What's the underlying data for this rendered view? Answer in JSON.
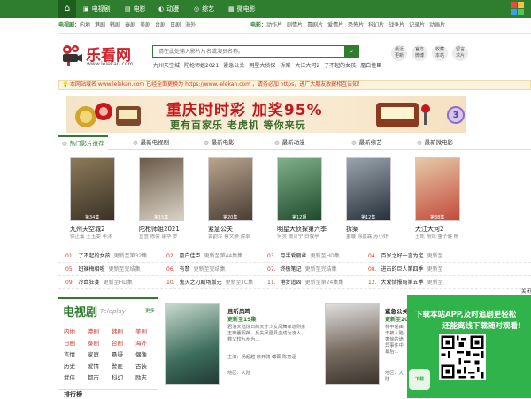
{
  "topnav": {
    "home_icon": "home-icon",
    "items": [
      {
        "label": "电视剧",
        "icon": "tv-icon",
        "glyph": "▣"
      },
      {
        "label": "电影",
        "icon": "film-icon",
        "glyph": "▤"
      },
      {
        "label": "动漫",
        "icon": "anime-icon",
        "glyph": "◐"
      },
      {
        "label": "综艺",
        "icon": "variety-icon",
        "glyph": "◎"
      },
      {
        "label": "微电影",
        "icon": "micro-film-icon",
        "glyph": "▦"
      }
    ]
  },
  "category_rows": {
    "tv": {
      "title": "电视剧：",
      "items": [
        "内地",
        "港剧",
        "韩剧",
        "泰剧",
        "美剧",
        "台剧",
        "日剧",
        "海外"
      ]
    },
    "movie": {
      "title": "电影：",
      "items": [
        "动作片",
        "剧情片",
        "喜剧片",
        "爱情片",
        "恐怖片",
        "科幻片",
        "战争片",
        "记录片",
        "动画片"
      ]
    }
  },
  "logo": {
    "name": "乐看网",
    "url": "www.lelekan.com"
  },
  "search": {
    "placeholder": "请在此处输入影片片名或演员名称。",
    "button": "⌕"
  },
  "hotwords": [
    "九州天空城",
    "陀枪师姐2021",
    "紧急公关",
    "明星大侦探",
    "拆案",
    "大江大河2",
    "了不起的女孩",
    "凰白佳臣"
  ],
  "circle_buttons": [
    {
      "line1": "最近",
      "line2": "更新"
    },
    {
      "line1": "官方",
      "line2": "微博"
    },
    {
      "line1": "收藏",
      "line2": "本站"
    },
    {
      "line1": "留言",
      "line2": "求片"
    }
  ],
  "notice": {
    "icon": "💡",
    "text": "本网站域名 www.lelekan.com 已经全面更换为 https://www.lelekan.com ，请务必加 https，进广大朋友收藏相互告知！"
  },
  "banner": {
    "line1": "重庆时时彩 加奖95%",
    "line2": "更有百家乐 老虎机 等你来玩",
    "badge": "3"
  },
  "tabs": [
    {
      "label": "热门影片推荐",
      "glyph": "◍"
    },
    {
      "label": "最新电视剧",
      "glyph": "◍"
    },
    {
      "label": "最新电影",
      "glyph": "◍"
    },
    {
      "label": "最新动漫",
      "glyph": "◍"
    },
    {
      "label": "最新综艺",
      "glyph": "◍"
    },
    {
      "label": "最新微电影",
      "glyph": "◍"
    }
  ],
  "posters": [
    {
      "title": "九州天空城2",
      "cast": "徐正溪 王玉雯 李沐",
      "tag": "第34集",
      "color1": "#3a3226",
      "color2": "#8c7a58"
    },
    {
      "title": "陀枪师姐2021",
      "cast": "宣萱 陈豪 康华 罗",
      "tag": "第15集",
      "color1": "#d9d3c6",
      "color2": "#6b5a48"
    },
    {
      "title": "紧急公关",
      "cast": "黄韵玲 蔡文静 谭卓",
      "tag": "第20集",
      "color1": "#4a3d35",
      "color2": "#b9a48c"
    },
    {
      "title": "明星大侦探第六季",
      "cast": "何炅 撒贝宁 白敬亭",
      "tag": "第12期",
      "color1": "#1f4a2c",
      "color2": "#7fb08a"
    },
    {
      "title": "拆案",
      "cast": "董璇 徐嘉霖 苏小妤",
      "tag": "第12集",
      "color1": "#27303a",
      "color2": "#9aa4ac"
    },
    {
      "title": "大江大河2",
      "cast": "王凯 杨烁 董子健 杨",
      "tag": "第38集",
      "color1": "#c24a3a",
      "color2": "#e6c9a8"
    }
  ],
  "rank_rows": [
    [
      {
        "num": "01.",
        "name": "了不起的女孩",
        "ep": "更新至第32集"
      },
      {
        "num": "02.",
        "name": "凰白佳臣",
        "ep": "更新至第44集集"
      },
      {
        "num": "03.",
        "name": "月半爱丽丝",
        "ep": "更新至HD集"
      },
      {
        "num": "04.",
        "name": "百岁之好一言为定",
        "ep": "更新至"
      }
    ],
    [
      {
        "num": "05.",
        "name": "斑斓梅相啦",
        "ep": "更新至完结集"
      },
      {
        "num": "06.",
        "name": "有翡",
        "ep": "更新至完结集"
      },
      {
        "num": "07.",
        "name": "终极笔记",
        "ep": "更新至完结集"
      },
      {
        "num": "08.",
        "name": "进击的巨人第四季",
        "ep": "更新至"
      }
    ],
    [
      {
        "num": "09.",
        "name": "冷血狂宴",
        "ep": "更新至HD集"
      },
      {
        "num": "10.",
        "name": "鬼灭之刃剧场版无",
        "ep": "更新至TC集"
      },
      {
        "num": "11.",
        "name": "港梦追凶",
        "ep": "更新至第24集集"
      },
      {
        "num": "12.",
        "name": "大爱情报局第五季",
        "ep": "更新至"
      }
    ]
  ],
  "tv_section": {
    "title": "电视剧",
    "en": "Teleplay",
    "more": "更多",
    "cats": [
      {
        "label": "内地",
        "hl": true
      },
      {
        "label": "港剧",
        "hl": true
      },
      {
        "label": "韩剧",
        "hl": true
      },
      {
        "label": "美剧",
        "hl": true
      },
      {
        "label": "日剧",
        "hl": true
      },
      {
        "label": "泰剧",
        "hl": true
      },
      {
        "label": "台剧",
        "hl": true
      },
      {
        "label": "海外",
        "hl": true
      },
      {
        "label": "言情",
        "hl": false
      },
      {
        "label": "家庭",
        "hl": false
      },
      {
        "label": "悬疑",
        "hl": false
      },
      {
        "label": "偶像",
        "hl": false
      },
      {
        "label": "历史",
        "hl": false
      },
      {
        "label": "爱情",
        "hl": false
      },
      {
        "label": "警匪",
        "hl": false
      },
      {
        "label": "古装",
        "hl": false
      },
      {
        "label": "武侠",
        "hl": false
      },
      {
        "label": "都市",
        "hl": false
      },
      {
        "label": "科幻",
        "hl": false
      },
      {
        "label": "励志",
        "hl": false
      }
    ],
    "rank_title": "排行榜"
  },
  "featured": [
    {
      "title": "且听凤鸣",
      "update": "更新至19集",
      "desc": "君洛天陆惊日的天才少女凤舞孝道则亲王奔蹇熙英，反失凤凰具血成为凌人，救父较九州为...",
      "cast": "主演：杨超越 徐开骋 傅菁 陈意涵",
      "area": "地区：大陆"
    },
    {
      "title": "紧急公关",
      "update": "更新至20集",
      "desc": "林中瑶由于被人陷害惊的诡异事件中幕后...",
      "cast": "主演：",
      "area": "地区：大陆"
    }
  ],
  "qr_panel": {
    "close": "关闭",
    "line1": "下载本站APP,及时追剧更轻松",
    "line2": "还能离线下载随时观看!",
    "download": "下载"
  }
}
